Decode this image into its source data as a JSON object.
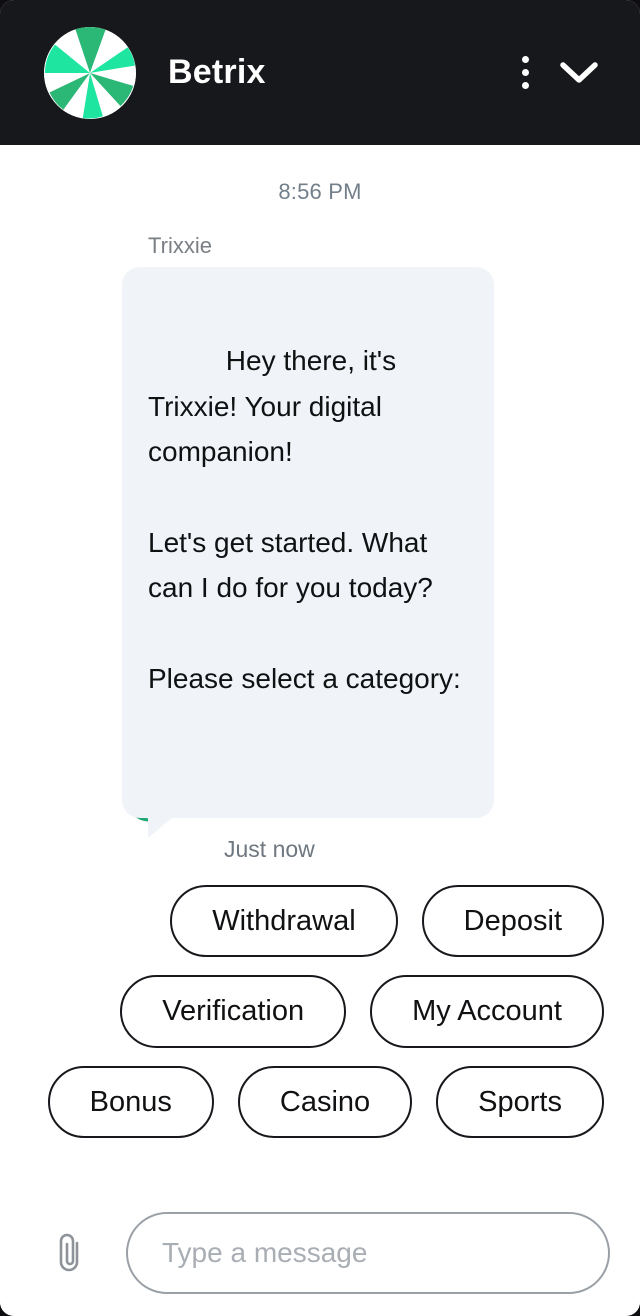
{
  "header": {
    "brand_name": "Betrix",
    "logo_icon": "pinwheel-logo",
    "menu_icon": "more-vertical-icon",
    "collapse_icon": "chevron-down-icon",
    "background_color": "#17181c",
    "brand_green": "#19c37d",
    "brand_green_light": "#36e5a5"
  },
  "conversation": {
    "timestamp": "8:56 PM",
    "message": {
      "sender": "Trixxie",
      "avatar_icon": "sprout-face-avatar",
      "text": "Hey there, it's Trixxie! Your digital companion!\n\nLet's get started. What can I do for you today?\n\nPlease select a category:",
      "stamp": "Just now",
      "bubble_color": "#f0f3f7"
    }
  },
  "quick_replies": {
    "rows": [
      {
        "items": [
          {
            "label": "Withdrawal"
          },
          {
            "label": "Deposit"
          }
        ]
      },
      {
        "items": [
          {
            "label": "Verification"
          },
          {
            "label": "My Account"
          }
        ]
      },
      {
        "items": [
          {
            "label": "Bonus"
          },
          {
            "label": "Casino"
          },
          {
            "label": "Sports"
          }
        ]
      }
    ]
  },
  "composer": {
    "attach_icon": "paperclip-icon",
    "input_value": "",
    "input_placeholder": "Type a message"
  }
}
